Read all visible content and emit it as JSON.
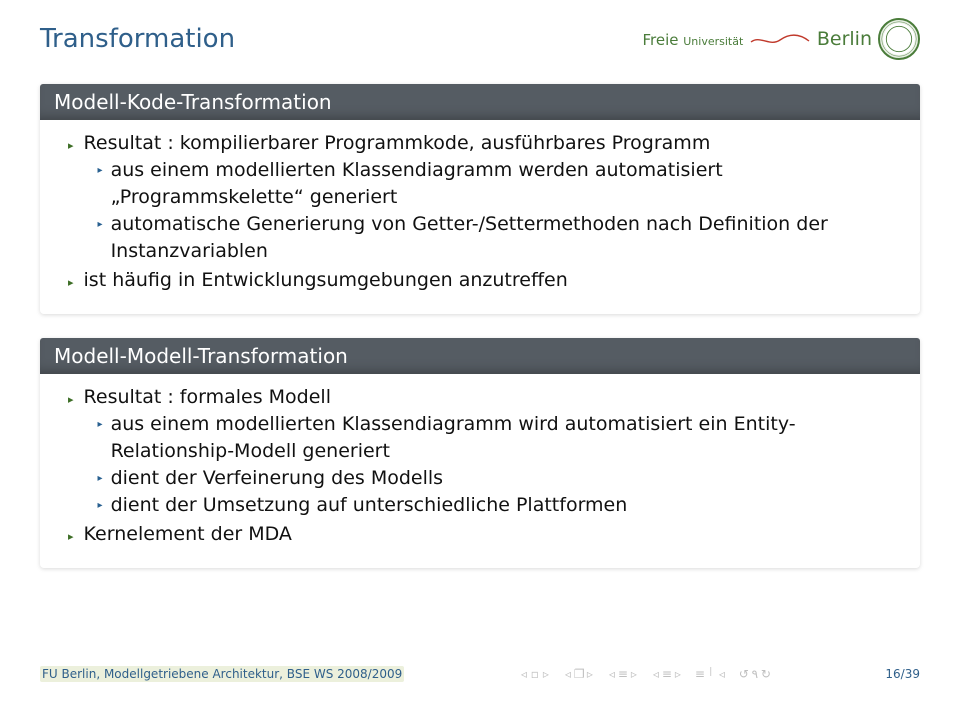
{
  "header": {
    "title": "Transformation",
    "logo_free": "Freie",
    "logo_uni": "Universität",
    "logo_berlin": "Berlin"
  },
  "block1": {
    "title": "Modell-Kode-Transformation",
    "i1_head": "Resultat : kompilierbarer Programmkode, ausführbares Programm",
    "i1_s1": "aus einem modellierten Klassendiagramm werden automatisiert „Programmskelette“ generiert",
    "i1_s2": "automatische Generierung von Getter-/Settermethoden nach Definition der Instanzvariablen",
    "i2": "ist häufig in Entwicklungsumgebungen anzutreffen"
  },
  "block2": {
    "title": "Modell-Modell-Transformation",
    "i1_head": "Resultat : formales Modell",
    "i1_s1": "aus einem modellierten Klassendiagramm wird automatisiert ein Entity-Relationship-Modell generiert",
    "i1_s2": "dient der Verfeinerung des Modells",
    "i1_s3": "dient der Umsetzung auf unterschiedliche Plattformen",
    "i2": "Kernelement der MDA"
  },
  "footer": {
    "left": "FU Berlin, Modellgetriebene Architektur, BSE WS 2008/2009",
    "page": "16/39"
  }
}
